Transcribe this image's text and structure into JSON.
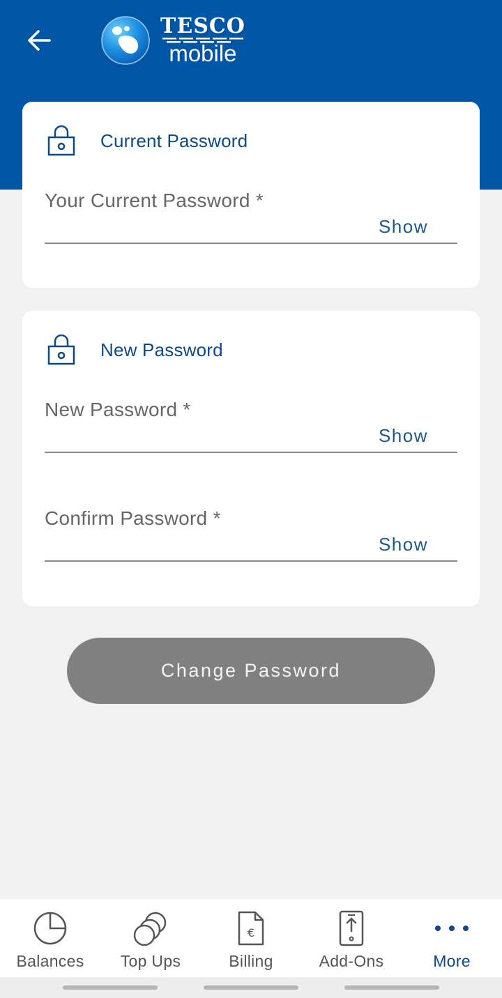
{
  "header": {
    "back_label": "Back",
    "logo_brand": "TESCO",
    "logo_product": "mobile",
    "background": "#0056a5"
  },
  "current_password_card": {
    "title": "Current Password",
    "icon": "lock-icon",
    "field": {
      "label": "Your Current Password *",
      "value": "",
      "show_label": "Show"
    }
  },
  "new_password_card": {
    "title": "New Password",
    "icon": "lock-icon",
    "new_field": {
      "label": "New Password *",
      "value": "",
      "show_label": "Show"
    },
    "confirm_field": {
      "label": "Confirm Password *",
      "value": "",
      "show_label": "Show"
    }
  },
  "change_button": {
    "label": "Change Password",
    "state": "disabled"
  },
  "bottom_nav": {
    "items": [
      {
        "label": "Balances",
        "icon": "pie-chart-icon"
      },
      {
        "label": "Top Ups",
        "icon": "coins-icon"
      },
      {
        "label": "Billing",
        "icon": "euro-document-icon"
      },
      {
        "label": "Add-Ons",
        "icon": "phone-upload-icon"
      },
      {
        "label": "More",
        "icon": "more-dots-icon"
      }
    ],
    "active": "More"
  },
  "colors": {
    "brand_blue": "#0056a5",
    "title_blue": "#0b4a87",
    "button_disabled": "#808080",
    "page_background": "#f1f1f1"
  }
}
